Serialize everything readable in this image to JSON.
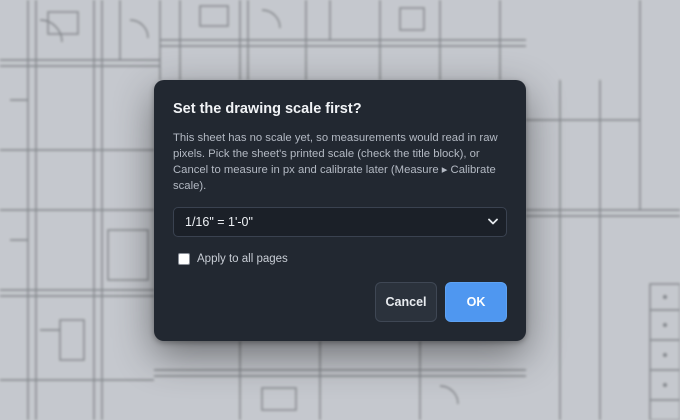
{
  "dialog": {
    "title": "Set the drawing scale first?",
    "body": "This sheet has no scale yet, so measurements would read in raw pixels. Pick the sheet's printed scale (check the title block), or Cancel to measure in px and calibrate later (Measure ▸ Calibrate scale).",
    "scale_select": {
      "value": "1/16\" = 1'-0\""
    },
    "apply_all": {
      "label": "Apply to all pages",
      "checked": false
    },
    "cancel_label": "Cancel",
    "ok_label": "OK"
  },
  "colors": {
    "dialog_bg": "#222831",
    "primary": "#4f97f0",
    "backdrop": "#c4c7cc"
  }
}
